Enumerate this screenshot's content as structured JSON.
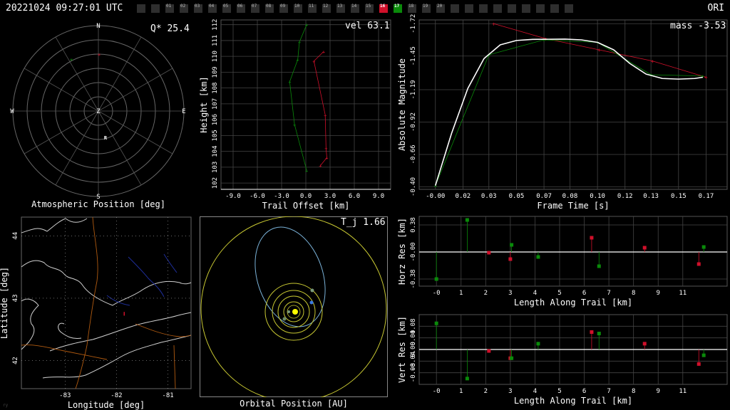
{
  "header": {
    "timestamp": "20221024 09:27:01 UTC",
    "shower": "ORI",
    "station_cells": [
      {
        "label": "",
        "state": "off"
      },
      {
        "label": "",
        "state": "off"
      },
      {
        "label": "01",
        "state": "off"
      },
      {
        "label": "02",
        "state": "off"
      },
      {
        "label": "03",
        "state": "off"
      },
      {
        "label": "04",
        "state": "off"
      },
      {
        "label": "05",
        "state": "off"
      },
      {
        "label": "06",
        "state": "off"
      },
      {
        "label": "07",
        "state": "off"
      },
      {
        "label": "08",
        "state": "off"
      },
      {
        "label": "09",
        "state": "off"
      },
      {
        "label": "10",
        "state": "off"
      },
      {
        "label": "11",
        "state": "off"
      },
      {
        "label": "12",
        "state": "off"
      },
      {
        "label": "13",
        "state": "off"
      },
      {
        "label": "14",
        "state": "off"
      },
      {
        "label": "15",
        "state": "off"
      },
      {
        "label": "16",
        "state": "red"
      },
      {
        "label": "17",
        "state": "green"
      },
      {
        "label": "18",
        "state": "off"
      },
      {
        "label": "19",
        "state": "off"
      },
      {
        "label": "20",
        "state": "off"
      },
      {
        "label": "",
        "state": "off"
      },
      {
        "label": "",
        "state": "off"
      },
      {
        "label": "",
        "state": "off"
      },
      {
        "label": "",
        "state": "off"
      },
      {
        "label": "",
        "state": "off"
      },
      {
        "label": "",
        "state": "off"
      },
      {
        "label": "",
        "state": "off"
      },
      {
        "label": "",
        "state": "off"
      },
      {
        "label": "",
        "state": "off"
      }
    ]
  },
  "colors": {
    "station_a": "#d0102a",
    "station_b": "#0a8a0a",
    "fit": "#ffffff",
    "orbit": "#c8c832",
    "map_coast": "#d0d0d0",
    "map_border": "#b05a10",
    "map_river": "#1e2e9a"
  },
  "panels": {
    "atmospheric": {
      "title": "Atmospheric Position [deg]",
      "q_label": "Q* 25.4",
      "compass": {
        "n": "N",
        "s": "S",
        "e": "E",
        "w": "W",
        "z": "Z",
        "r": "R"
      }
    },
    "trail": {
      "vel_label": "vel 63.1"
    },
    "magnitude": {
      "mass_label": "mass -3.53"
    },
    "map": {},
    "orbit": {
      "title": "Orbital Position [AU]",
      "tj_label": "T_j 1.66"
    },
    "footer_mark": "ry"
  },
  "chart_data": [
    {
      "id": "trail",
      "type": "line",
      "xlabel": "Trail Offset [km]",
      "ylabel": "Height [km]",
      "xlim": [
        -10.5,
        10.5
      ],
      "ylim": [
        101.6,
        112.3
      ],
      "xticks": [
        "-9.0",
        "-6.0",
        "-3.0",
        "0.0",
        "3.0",
        "6.0",
        "9.0"
      ],
      "xtick_values": [
        -9,
        -6,
        -3,
        0,
        3,
        6,
        9
      ],
      "yticks": [
        "102",
        "103",
        "104",
        "105",
        "106",
        "107",
        "108",
        "109",
        "110",
        "111",
        "112"
      ],
      "ytick_values": [
        102,
        103,
        104,
        105,
        106,
        107,
        108,
        109,
        110,
        111,
        112
      ],
      "series": [
        {
          "color": "#d0102a",
          "x": [
            2.2,
            1.0,
            2.4,
            2.5,
            2.6,
            1.8
          ],
          "y": [
            110.3,
            109.7,
            106.3,
            104.2,
            103.6,
            103.1
          ]
        },
        {
          "color": "#0a8a0a",
          "x": [
            0.1,
            -0.8,
            -1.0,
            -2.0,
            -1.4,
            0.1
          ],
          "y": [
            112.0,
            110.9,
            109.8,
            108.4,
            105.7,
            102.8
          ]
        }
      ]
    },
    {
      "id": "magnitude",
      "type": "line",
      "xlabel": "Frame Time [s]",
      "ylabel": "Absolute Magnitude",
      "xlim": [
        -0.01,
        0.18
      ],
      "ylim": [
        -0.46,
        -1.82
      ],
      "xticks": [
        "-0.00",
        "0.02",
        "0.03",
        "0.05",
        "0.07",
        "0.08",
        "0.10",
        "0.12",
        "0.13",
        "0.15",
        "0.17"
      ],
      "xtick_values": [
        0.0,
        0.017,
        0.033,
        0.05,
        0.067,
        0.083,
        0.1,
        0.117,
        0.133,
        0.15,
        0.167
      ],
      "yticks": [
        "-0.40",
        "-0.66",
        "-0.92",
        "-1.19",
        "-1.45",
        "-1.72"
      ],
      "ytick_values": [
        -0.48,
        -0.74,
        -1.0,
        -1.26,
        -1.53,
        -1.79
      ],
      "series": [
        {
          "color": "#d0102a",
          "x": [
            0.036,
            0.068,
            0.101,
            0.134,
            0.167
          ],
          "y": [
            -1.79,
            -1.67,
            -1.58,
            -1.49,
            -1.36
          ]
        },
        {
          "color": "#0a8a0a",
          "x": [
            0.0,
            0.033,
            0.067,
            0.1,
            0.133,
            0.165
          ],
          "y": [
            -0.49,
            -1.54,
            -1.66,
            -1.64,
            -1.38,
            -1.37
          ]
        },
        {
          "color": "#ffffff",
          "x": [
            0.0,
            0.01,
            0.02,
            0.03,
            0.04,
            0.05,
            0.06,
            0.07,
            0.08,
            0.09,
            0.1,
            0.11,
            0.12,
            0.13,
            0.14,
            0.15,
            0.16,
            0.165
          ],
          "y": [
            -0.49,
            -0.91,
            -1.27,
            -1.51,
            -1.62,
            -1.655,
            -1.664,
            -1.665,
            -1.666,
            -1.66,
            -1.64,
            -1.58,
            -1.47,
            -1.385,
            -1.35,
            -1.345,
            -1.35,
            -1.36
          ]
        }
      ]
    },
    {
      "id": "horz_res",
      "type": "scatter",
      "xlabel": "Length Along Trail [km]",
      "ylabel": "Horz Res [km]",
      "xlim": [
        -0.7,
        11.8
      ],
      "ylim": [
        -0.48,
        0.5
      ],
      "xticks": [
        "-0",
        "1",
        "2",
        "3",
        "4",
        "5",
        "6",
        "7",
        "8",
        "9",
        "11"
      ],
      "xtick_values": [
        0,
        1,
        2,
        3,
        4,
        5,
        6,
        7,
        8,
        9,
        10
      ],
      "yticks": [
        "0.38",
        "-0.00",
        "-0.38"
      ],
      "ytick_values": [
        0.38,
        0.0,
        -0.38
      ],
      "series": [
        {
          "color": "#d0102a",
          "x": [
            2.13,
            3.0,
            6.3,
            8.45,
            10.65
          ],
          "y": [
            -0.01,
            -0.1,
            0.2,
            0.06,
            -0.17
          ]
        },
        {
          "color": "#0a8a0a",
          "x": [
            0.0,
            1.25,
            3.05,
            4.13,
            6.6,
            10.85
          ],
          "y": [
            -0.38,
            0.45,
            0.1,
            -0.07,
            -0.2,
            0.07
          ]
        }
      ]
    },
    {
      "id": "vert_res",
      "type": "scatter",
      "xlabel": "Length Along Trail [km]",
      "ylabel": "Vert Res [km]",
      "xlim": [
        -0.7,
        11.8
      ],
      "ylim": [
        -0.12,
        0.12
      ],
      "xticks": [
        "-0",
        "1",
        "2",
        "3",
        "4",
        "5",
        "6",
        "7",
        "8",
        "9",
        "11"
      ],
      "xtick_values": [
        0,
        1,
        2,
        3,
        4,
        5,
        6,
        7,
        8,
        9,
        10
      ],
      "yticks": [
        "0.08",
        "0.04",
        "0.00",
        "-0.04",
        "-0.08"
      ],
      "ytick_values": [
        0.08,
        0.04,
        0.0,
        -0.04,
        -0.08
      ],
      "series": [
        {
          "color": "#d0102a",
          "x": [
            2.13,
            3.0,
            6.3,
            8.45,
            10.65
          ],
          "y": [
            -0.005,
            -0.03,
            0.06,
            0.02,
            -0.05
          ]
        },
        {
          "color": "#0a8a0a",
          "x": [
            0.0,
            1.25,
            3.05,
            4.13,
            6.6,
            10.85
          ],
          "y": [
            0.09,
            -0.1,
            -0.03,
            0.02,
            0.055,
            -0.02
          ]
        }
      ]
    },
    {
      "id": "map",
      "type": "line",
      "xlabel": "Longitude [deg]",
      "ylabel": "Latitude [deg]",
      "xlim": [
        -83.85,
        -80.55
      ],
      "ylim": [
        41.55,
        44.3
      ],
      "xticks": [
        "-83",
        "-82",
        "-81"
      ],
      "xtick_values": [
        -83,
        -82,
        -81
      ],
      "yticks": [
        "44",
        "43",
        "42"
      ],
      "ytick_values": [
        44,
        43,
        42
      ],
      "series": [
        {
          "color": "#d0102a",
          "x": [
            -81.85,
            -81.85
          ],
          "y": [
            42.78,
            42.72
          ]
        }
      ]
    }
  ]
}
